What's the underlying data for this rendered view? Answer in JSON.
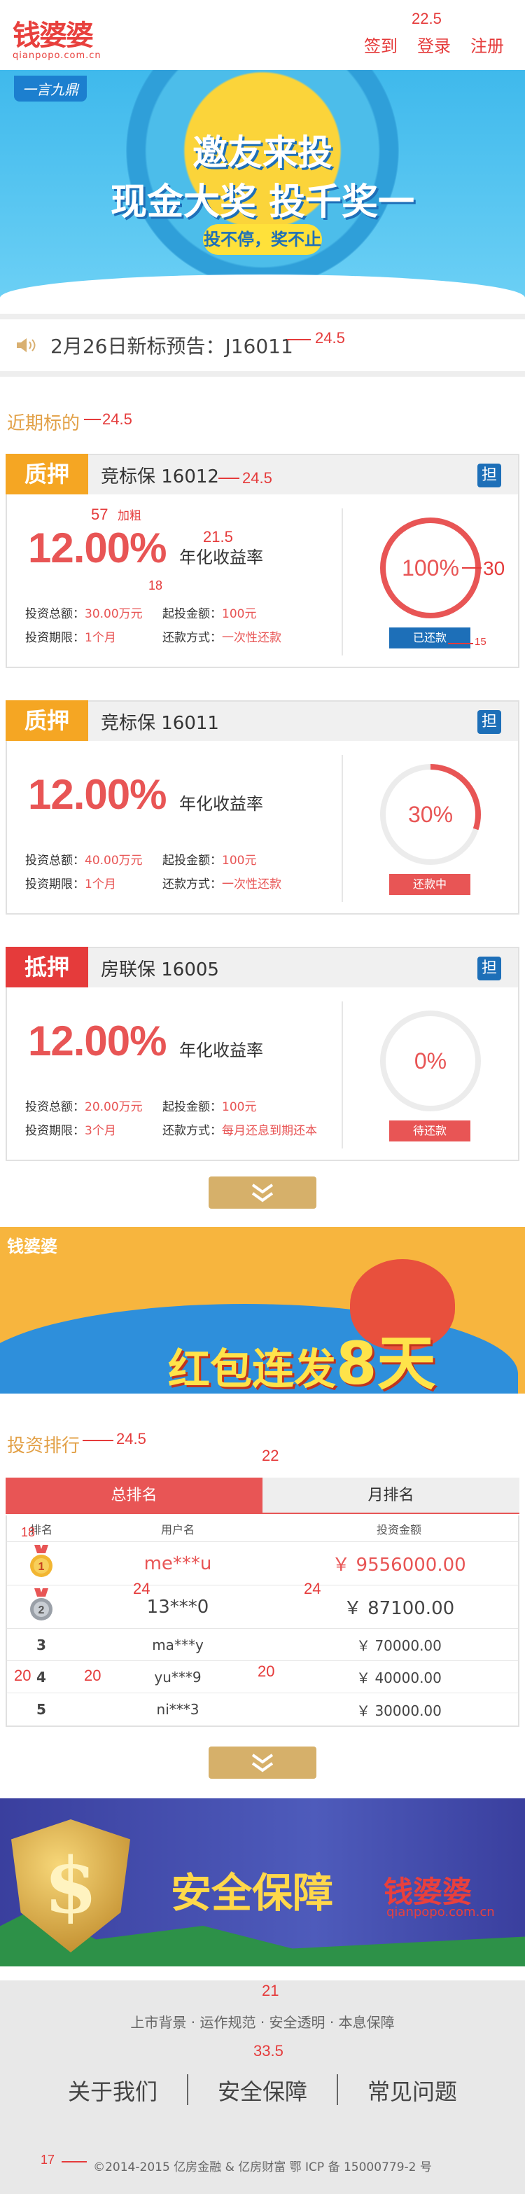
{
  "header": {
    "logo_cn": "钱婆婆",
    "logo_en": "qianpopo.com.cn",
    "links": [
      "签到",
      "登录",
      "注册"
    ]
  },
  "banner1": {
    "tag": "一言九鼎",
    "line1": "邀友来投",
    "line2": "现金大奖 投千奖一",
    "line3": "投不停，奖不止"
  },
  "notice": {
    "text": "2月26日新标预告：J16011"
  },
  "recent": {
    "title": "近期标的"
  },
  "cards": [
    {
      "badge": "质押",
      "badge_color": "#f5a623",
      "name": "竞标保 16012",
      "guarantee": "担",
      "rate": "12.00%",
      "rate_label": "年化收益率",
      "total_label": "投资总额：",
      "total": "30.00万元",
      "min_label": "起投金额：",
      "min": "100元",
      "term_label": "投资期限：",
      "term": "1个月",
      "repay_label": "还款方式：",
      "repay": "一次性还款",
      "progress": 100,
      "progress_text": "100%",
      "status": "已还款",
      "status_color": "#1d6fb8"
    },
    {
      "badge": "质押",
      "badge_color": "#f5a623",
      "name": "竞标保 16011",
      "guarantee": "担",
      "rate": "12.00%",
      "rate_label": "年化收益率",
      "total_label": "投资总额：",
      "total": "40.00万元",
      "min_label": "起投金额：",
      "min": "100元",
      "term_label": "投资期限：",
      "term": "1个月",
      "repay_label": "还款方式：",
      "repay": "一次性还款",
      "progress": 30,
      "progress_text": "30%",
      "status": "还款中",
      "status_color": "#e85555"
    },
    {
      "badge": "抵押",
      "badge_color": "#e53b3b",
      "name": "房联保 16005",
      "guarantee": "担",
      "rate": "12.00%",
      "rate_label": "年化收益率",
      "total_label": "投资总额：",
      "total": "20.00万元",
      "min_label": "起投金额：",
      "min": "100元",
      "term_label": "投资期限：",
      "term": "3个月",
      "repay_label": "还款方式：",
      "repay": "每月还息到期还本",
      "progress": 0,
      "progress_text": "0%",
      "status": "待还款",
      "status_color": "#e85555"
    }
  ],
  "banner2": {
    "logo": "钱婆婆",
    "text": "红包连发",
    "big": "8天"
  },
  "ranking": {
    "title": "投资排行",
    "tabs": [
      "总排名",
      "月排名"
    ],
    "headers": [
      "排名",
      "用户名",
      "投资金额"
    ],
    "rows": [
      {
        "rank": "1",
        "user": "me***u",
        "amount": "￥ 9556000.00"
      },
      {
        "rank": "2",
        "user": "13***0",
        "amount": "￥ 87100.00"
      },
      {
        "rank": "3",
        "user": "ma***y",
        "amount": "￥ 70000.00"
      },
      {
        "rank": "4",
        "user": "yu***9",
        "amount": "￥ 40000.00"
      },
      {
        "rank": "5",
        "user": "ni***3",
        "amount": "￥ 30000.00"
      }
    ]
  },
  "banner3": {
    "title": "安全保障",
    "logo_cn": "钱婆婆",
    "logo_en": "qianpopo.com.cn"
  },
  "footer": {
    "sub": "上市背景 · 运作规范 · 安全透明 · 本息保障",
    "links": [
      "关于我们",
      "安全保障",
      "常见问题"
    ],
    "copyright": "©2014-2015 亿房金融 & 亿房财富 鄂 ICP 备 15000779-2 号"
  },
  "annotations": {
    "a22_5": "22.5",
    "a24_5": "24.5",
    "a57": "57",
    "bold": "加粗",
    "a21_5": "21.5",
    "a18": "18",
    "a30": "30",
    "a15": "15",
    "a22": "22",
    "a24": "24",
    "a20": "20",
    "a21": "21",
    "a33_5": "33.5",
    "a17": "17"
  }
}
